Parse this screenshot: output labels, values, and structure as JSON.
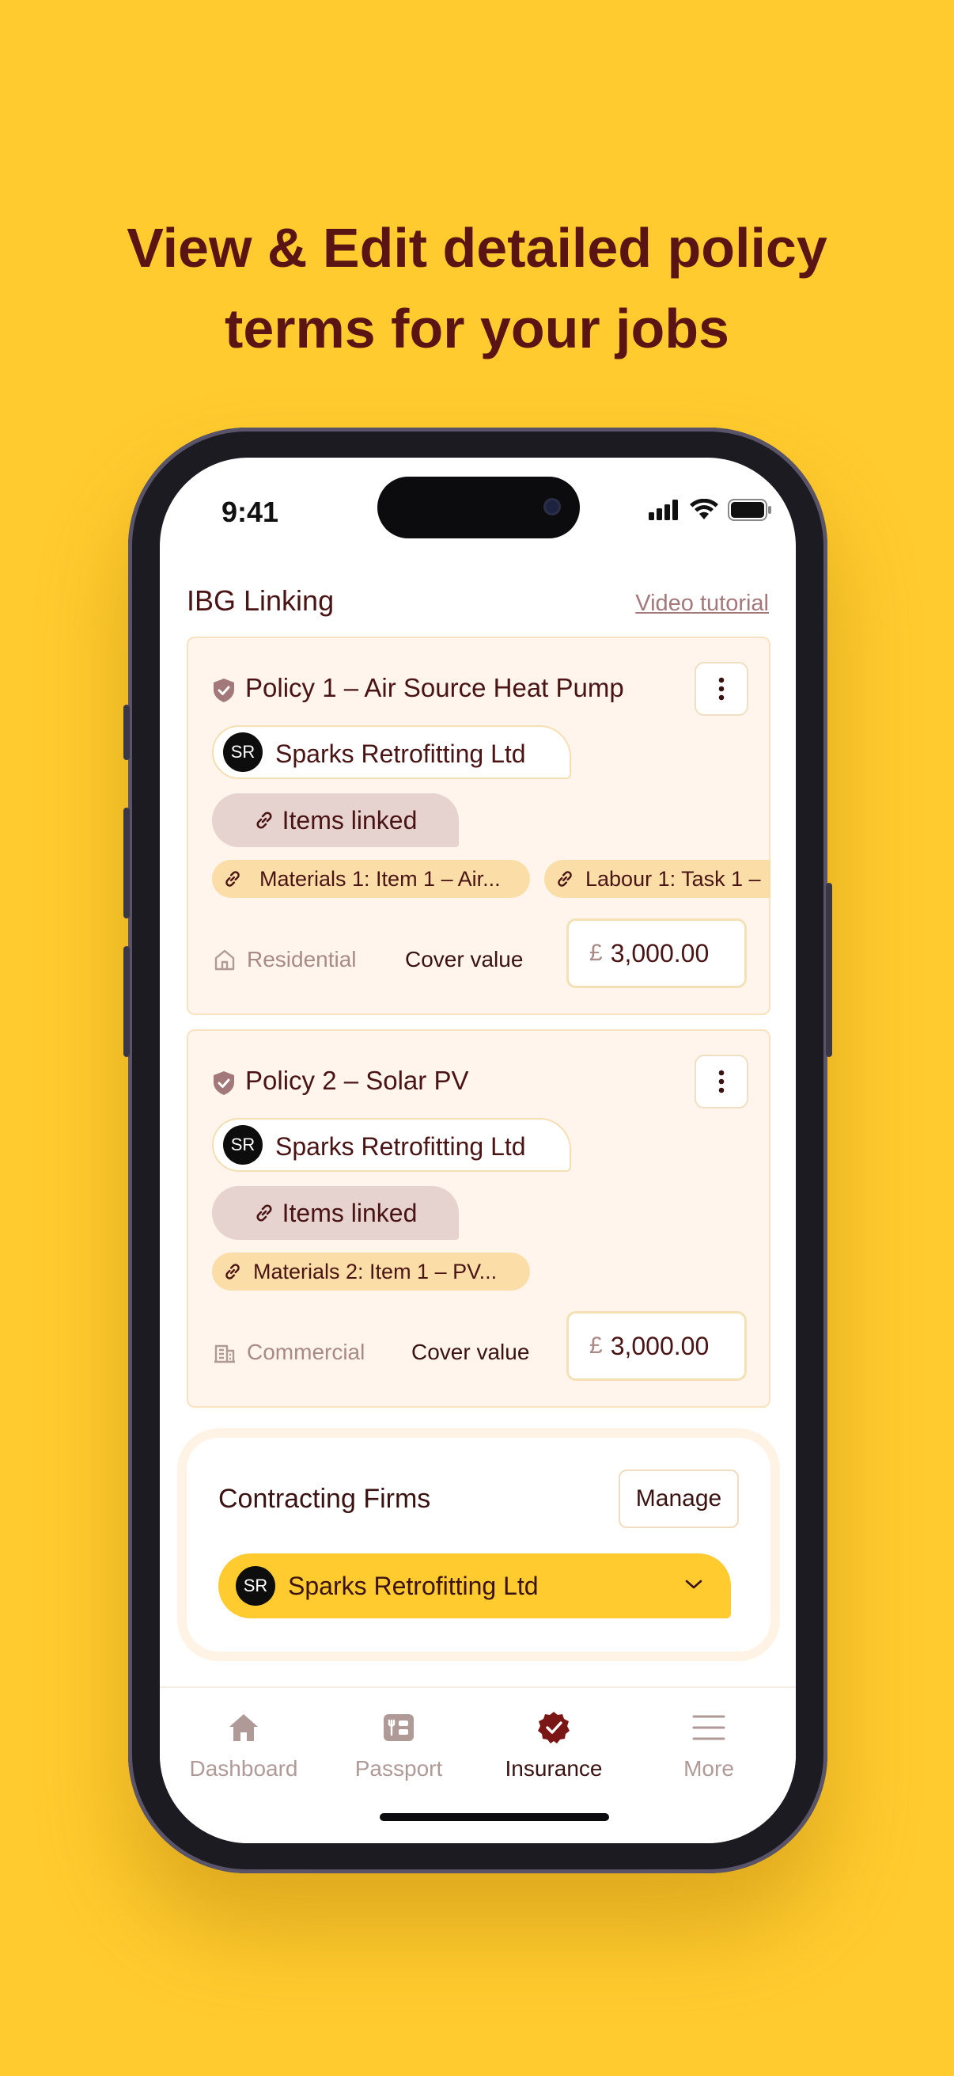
{
  "headline": {
    "line1": "View & Edit detailed policy",
    "line2": "terms for your jobs"
  },
  "status": {
    "time": "9:41"
  },
  "section": {
    "title": "IBG Linking",
    "video_link": "Video tutorial"
  },
  "policies": [
    {
      "title": "Policy 1 – Air Source Heat Pump",
      "firm_initials": "SR",
      "firm_name": "Sparks Retrofitting Ltd",
      "items_linked": "Items linked",
      "chips": [
        "Materials 1: Item 1 – Air...",
        "Labour 1: Task 1 –"
      ],
      "property_type": "Residential",
      "cover_label": "Cover value",
      "currency": "£",
      "cover_value": "3,000.00"
    },
    {
      "title": "Policy 2 – Solar PV",
      "firm_initials": "SR",
      "firm_name": "Sparks Retrofitting Ltd",
      "items_linked": "Items linked",
      "chips": [
        "Materials 2: Item 1 – PV..."
      ],
      "property_type": "Commercial",
      "cover_label": "Cover value",
      "currency": "£",
      "cover_value": "3,000.00"
    }
  ],
  "contracting_firms": {
    "title": "Contracting Firms",
    "manage_label": "Manage",
    "selected_initials": "SR",
    "selected_firm": "Sparks Retrofitting Ltd"
  },
  "tabbar": [
    {
      "label": "Dashboard",
      "icon": "home-icon"
    },
    {
      "label": "Passport",
      "icon": "passport-icon"
    },
    {
      "label": "Insurance",
      "icon": "insurance-badge-icon",
      "active": true
    },
    {
      "label": "More",
      "icon": "menu-icon"
    }
  ],
  "colors": {
    "background": "#FFCB2E",
    "headline": "#5b1414",
    "card_bg": "#FFF5EC",
    "chip": "#FBDDA7",
    "items_linked": "#E6D3D0",
    "accent_dark": "#7a1616"
  }
}
